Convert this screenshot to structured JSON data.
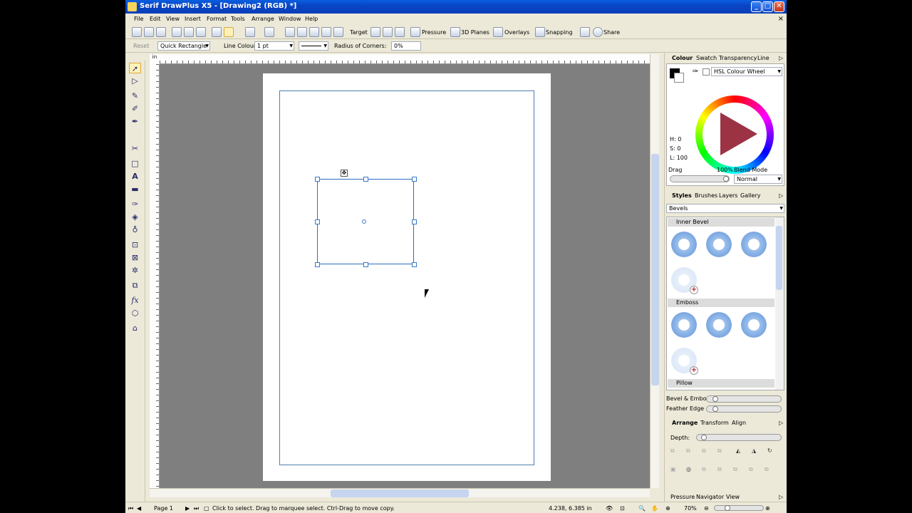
{
  "window": {
    "title": "Serif DrawPlus X5 - [Drawing2 (RGB) *]",
    "minimize": "_",
    "maximize": "□",
    "close": "✕"
  },
  "menu": {
    "items": [
      "File",
      "Edit",
      "View",
      "Insert",
      "Format",
      "Tools",
      "Arrange",
      "Window",
      "Help"
    ],
    "close_doc": "×"
  },
  "toolbar1": {
    "target_label": "Target",
    "pressure_label": "Pressure",
    "planes_label": "3D Planes",
    "overlays_label": "Overlays",
    "snapping_label": "Snapping",
    "share_label": "Share"
  },
  "toolbar2": {
    "reset_label": "Reset",
    "shape_label": "Quick Rectangle",
    "line_colour_label": "Line Colour",
    "line_width_value": "1 pt",
    "radius_label": "Radius of Corners:",
    "radius_value": "0%"
  },
  "ruler": {
    "unit": "in"
  },
  "status": {
    "page_label": "Page 1",
    "hint": "Click to select. Drag to marquee select. Ctrl-Drag to move copy.",
    "coords": "4.238, 6.385 in",
    "zoom": "70%"
  },
  "colour_panel": {
    "tabs": [
      "Colour",
      "Swatch",
      "Transparency",
      "Line"
    ],
    "mode": "HSL Colour Wheel",
    "h_label": "H: 0",
    "s_label": "S: 0",
    "l_label": "L: 100",
    "drag_label": "Drag",
    "opacity_value": "100%",
    "blend_label": "Blend Mode",
    "blend_value": "Normal"
  },
  "styles_panel": {
    "tabs": [
      "Styles",
      "Brushes",
      "Layers",
      "Gallery"
    ],
    "category": "Bevels",
    "sections": [
      "Inner Bevel",
      "Emboss",
      "Pillow"
    ],
    "bevel_label": "Bevel & Emboss",
    "feather_label": "Feather Edge"
  },
  "arrange_panel": {
    "tabs": [
      "Arrange",
      "Transform",
      "Align"
    ],
    "depth_label": "Depth:"
  },
  "bottom_tabs": [
    "Pressure",
    "Navigator",
    "View"
  ],
  "colors": {
    "titlebar": "#0a4fd4",
    "selection": "#2e6cc0",
    "canvas_bg": "#7f7f7f"
  }
}
